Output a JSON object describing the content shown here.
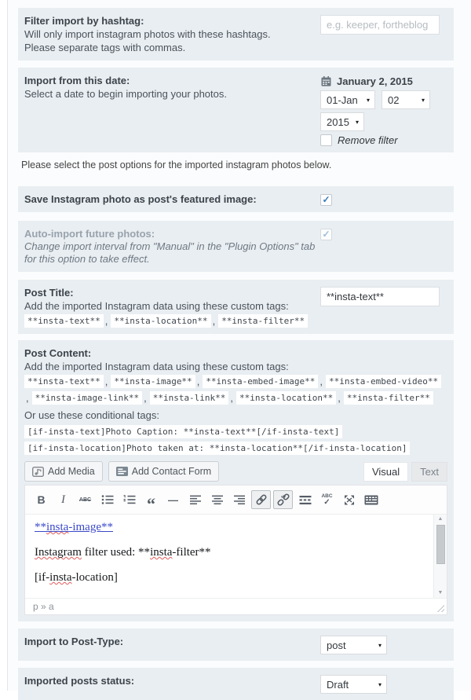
{
  "colors": {
    "section_bg": "#e9eef2",
    "accent_check_blue": "#3579b8",
    "editor_link_blue": "#3b49c9",
    "spellcheck_red": "#e05c5c"
  },
  "glyphs": {
    "check": "✓",
    "select_arrow": "▾",
    "scroll_up": "▲",
    "scroll_down": "▼",
    "tag_separator": ","
  },
  "hashtag": {
    "title": "Filter import by hashtag:",
    "line1": "Will only import instagram photos with these hashtags.",
    "line2": "Please separate tags with commas.",
    "placeholder": "e.g. keeper, fortheblog"
  },
  "date": {
    "title": "Import from this date:",
    "desc": "Select a date to begin importing your photos.",
    "display": "January 2, 2015",
    "month": "01-Jan",
    "day": "02",
    "year": "2015",
    "remove_filter_label": "Remove filter"
  },
  "intro_text": "Please select the post options for the imported instagram photos below.",
  "featured": {
    "title": "Save Instagram photo as post's featured image:"
  },
  "auto_import": {
    "title": "Auto-import future photos:",
    "line1": "Change import interval from \"Manual\" in the \"Plugin Options\" tab",
    "line2": "for this option to take effect."
  },
  "post_title": {
    "title": "Post Title:",
    "desc": "Add the imported Instagram data using these custom tags:",
    "tags": [
      "**insta-text**",
      "**insta-location**",
      "**insta-filter**"
    ],
    "input_value": "**insta-text**"
  },
  "post_content": {
    "title": "Post Content:",
    "desc": "Add the imported Instagram data using these custom tags:",
    "tags": [
      "**insta-text**",
      "**insta-image**",
      "**insta-embed-image**",
      "**insta-embed-video**",
      "**insta-image-link**",
      "**insta-link**",
      "**insta-location**",
      "**insta-filter**"
    ],
    "conditional_label": "Or use these conditional tags:",
    "conditional_tags": [
      "[if-insta-text]Photo Caption: **insta-text**[/if-insta-text]",
      "[if-insta-location]Photo taken at: **insta-location**[/if-insta-location]"
    ]
  },
  "editor": {
    "add_media_label": "Add Media",
    "add_contact_form_label": "Add Contact Form",
    "visual_tab": "Visual",
    "text_tab": "Text",
    "toolbar": {
      "bold": "B",
      "italic": "I",
      "strikethrough": "ABC",
      "blockquote": "“",
      "hr": "—",
      "spellcheck_text": "ABC",
      "spellcheck_check": "✓"
    },
    "content": {
      "line1": [
        "**",
        "insta",
        "-image**"
      ],
      "line2": [
        "Instagram",
        " filter used: **",
        "insta",
        "-filter**"
      ],
      "line3": [
        "[if-",
        "insta",
        "-location]"
      ],
      "status_path": "p » a"
    }
  },
  "post_type": {
    "title": "Import to Post-Type:",
    "value": "post"
  },
  "post_status": {
    "title": "Imported posts status:",
    "value": "Draft"
  }
}
